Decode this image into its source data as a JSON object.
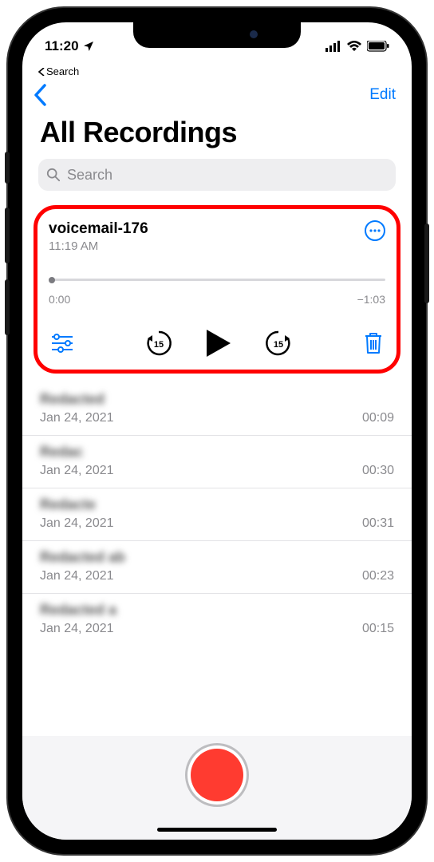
{
  "status": {
    "time": "11:20",
    "breadcrumb": "Search"
  },
  "nav": {
    "edit": "Edit"
  },
  "title": "All Recordings",
  "search": {
    "placeholder": "Search"
  },
  "selected": {
    "title": "voicemail-176",
    "subtitle": "11:19 AM",
    "elapsed": "0:00",
    "remaining": "−1:03"
  },
  "items": [
    {
      "title": "Redacted",
      "date": "Jan 24, 2021",
      "duration": "00:09"
    },
    {
      "title": "Redac",
      "date": "Jan 24, 2021",
      "duration": "00:30"
    },
    {
      "title": "Redacte",
      "date": "Jan 24, 2021",
      "duration": "00:31"
    },
    {
      "title": "Redacted ab",
      "date": "Jan 24, 2021",
      "duration": "00:23"
    },
    {
      "title": "Redacted a",
      "date": "Jan 24, 2021",
      "duration": "00:15"
    }
  ]
}
